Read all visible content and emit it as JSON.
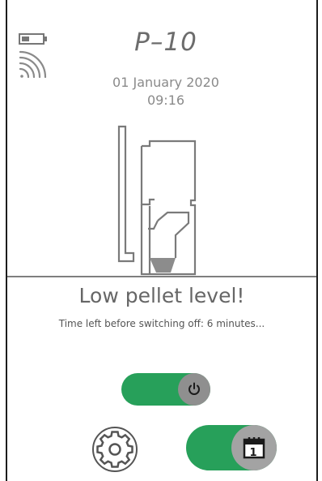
{
  "header": {
    "device_name": "P–10",
    "date": "01 January 2020",
    "time": "09:16"
  },
  "status": {
    "battery_icon": "battery-icon",
    "signal_icon": "wifi-signal-icon"
  },
  "alarm": {
    "title": "Low pellet level!",
    "message": "Time left before switching off: 6 minutes..."
  },
  "controls": {
    "power_toggle_icon": "power-icon",
    "power_state": "on",
    "settings_icon": "gear-icon",
    "schedule_toggle_icon": "calendar-icon",
    "schedule_state": "on",
    "calendar_day": "1"
  },
  "colors": {
    "toggle_on": "#27a05a",
    "knob": "#8f8f8f",
    "text": "#6c6c6c"
  }
}
